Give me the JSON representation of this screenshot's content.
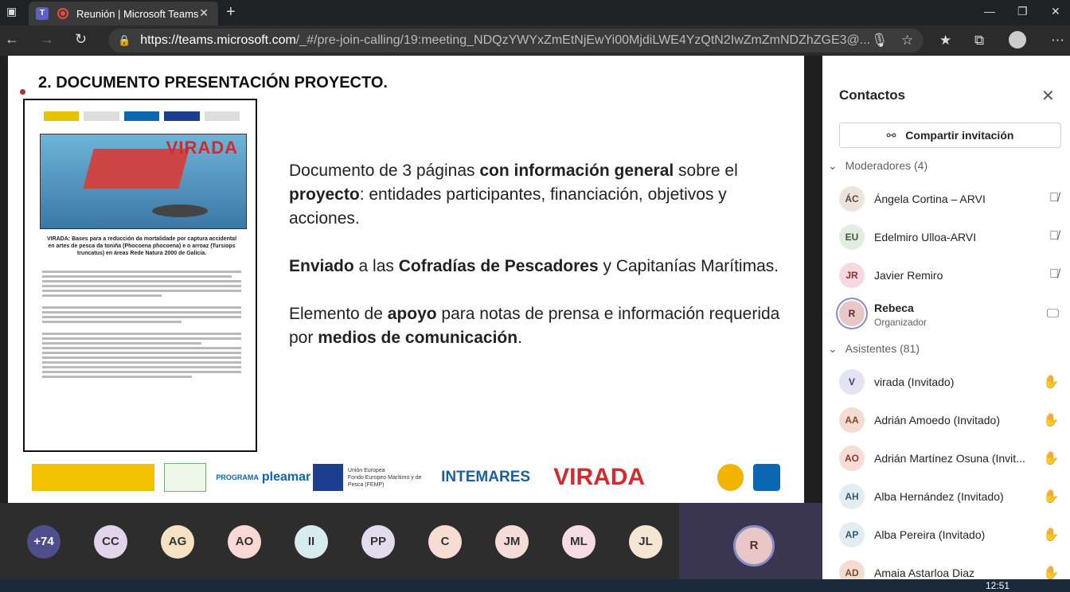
{
  "browser": {
    "tab_title": "Reunión | Microsoft Teams",
    "tab_icon": "record-icon",
    "url_host": "https://teams.microsoft.com",
    "url_path": "/_#/pre-join-calling/19:meeting_NDQzYWYxZmEtNjEwYi00MjdiLWE4YzQtN2IwZmZmNDZhZGE3@..."
  },
  "slide": {
    "title": "2. DOCUMENTO PRESENTACIÓN  PROYECTO.",
    "doc_banner_title": "VIRADA",
    "doc_heading": "VIRADA: Bases para a reducción da mortalidade por captura accidental en artes de pesca da toniña (Phocoena phocoena) e o arroaz (Tursiops truncatus) en áreas Rede Natura 2000 de Galicia.",
    "para1": {
      "a": "Documento de 3 páginas ",
      "b": "con información general",
      "c": " sobre el ",
      "d": "proyecto",
      "e": ": entidades participantes, financiación, objetivos y acciones."
    },
    "para2": {
      "a": "Enviado",
      "b": " a las ",
      "c": "Cofradías de Pescadores",
      "d": " y Capitanías Marítimas."
    },
    "para3": {
      "a": "Elemento de ",
      "b": "apoyo",
      "c": " para notas de prensa e información requerida por ",
      "d": "medios de comunicación",
      "e": "."
    },
    "footer_logos": {
      "programa": "PROGRAMA",
      "pleamar": "pleamar",
      "ue": "Unión Europea",
      "femp": "Fondo Europeo Marítimo y de Pesca (FEMP)",
      "intemares": "INTEMARES",
      "virada": "VIRADA"
    }
  },
  "participants_row": {
    "overflow": "+74",
    "people": [
      "CC",
      "AG",
      "AO",
      "II",
      "PP",
      "C",
      "JM",
      "ML",
      "JL"
    ],
    "self": "R"
  },
  "sidebar": {
    "title": "Contactos",
    "share_label": "Compartir invitación",
    "moderators_label": "Moderadores (4)",
    "moderators": [
      {
        "initials": "ÁC",
        "name": "Ángela Cortina – ARVI",
        "color": "#ece3dc"
      },
      {
        "initials": "EU",
        "name": "Edelmiro Ulloa-ARVI",
        "color": "#e3ece3"
      },
      {
        "initials": "JR",
        "name": "Javier Remiro",
        "color": "#f5d9de"
      },
      {
        "initials": "R",
        "name": "Rebeca",
        "role": "Organizador",
        "color": "#e9c7c7"
      }
    ],
    "attendees_label": "Asistentes (81)",
    "attendees": [
      {
        "initials": "V",
        "name": "virada (Invitado)",
        "color": "#e3e3f3"
      },
      {
        "initials": "AA",
        "name": "Adrián Amoedo (Invitado)",
        "color": "#f5dcd0"
      },
      {
        "initials": "AO",
        "name": "Adrián Martínez Osuna (Invit...",
        "color": "#f7dcd8"
      },
      {
        "initials": "AH",
        "name": "Alba Hernández (Invitado)",
        "color": "#e3ecef"
      },
      {
        "initials": "AP",
        "name": "Alba Pereira (Invitado)",
        "color": "#e3ecef"
      },
      {
        "initials": "AD",
        "name": "Amaia Astarloa Diaz",
        "color": "#f5dcd0"
      }
    ]
  },
  "taskbar": {
    "time": "12:51"
  }
}
